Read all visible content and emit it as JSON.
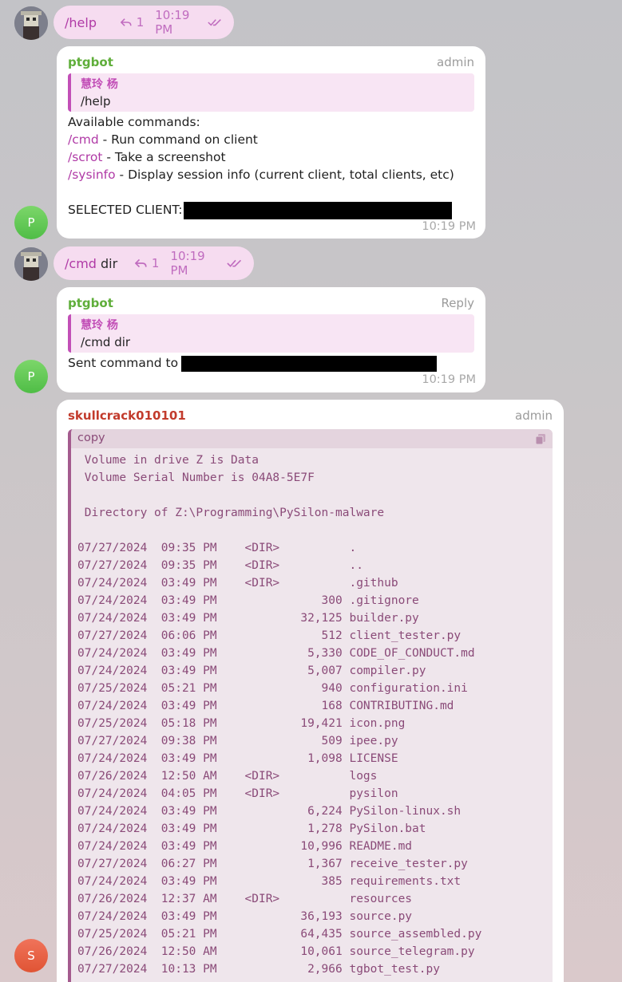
{
  "messages": {
    "m1": {
      "text": "/help",
      "reply_count": "1",
      "time": "10:19 PM"
    },
    "m2": {
      "sender": "ptgbot",
      "tag": "admin",
      "quote_name": "慧玲 杨",
      "quote_text": "/help",
      "heading": "Available commands:",
      "commands": [
        {
          "cmd": "/cmd",
          "desc": " - Run command on client"
        },
        {
          "cmd": "/scrot",
          "desc": " - Take a screenshot"
        },
        {
          "cmd": "/sysinfo",
          "desc": " - Display session info (current client, total clients, etc)"
        }
      ],
      "selected_label": "SELECTED CLIENT:",
      "time": "10:19 PM",
      "avatar_letter": "P"
    },
    "m3": {
      "cmd": "/cmd",
      "arg": " dir",
      "reply_count": "1",
      "time": "10:19 PM"
    },
    "m4": {
      "sender": "ptgbot",
      "tag": "Reply",
      "quote_name": "慧玲 杨",
      "quote_text": "/cmd dir",
      "text": "Sent command to",
      "time": "10:19 PM",
      "avatar_letter": "P"
    },
    "m5": {
      "sender": "skullcrack010101",
      "tag": "admin",
      "code_label": "copy",
      "avatar_letter": "S",
      "lines": [
        " Volume in drive Z is Data",
        " Volume Serial Number is 04A8-5E7F",
        "",
        " Directory of Z:\\Programming\\PySilon-malware",
        "",
        "07/27/2024  09:35 PM    <DIR>          .",
        "07/27/2024  09:35 PM    <DIR>          ..",
        "07/24/2024  03:49 PM    <DIR>          .github",
        "07/24/2024  03:49 PM               300 .gitignore",
        "07/24/2024  03:49 PM            32,125 builder.py",
        "07/27/2024  06:06 PM               512 client_tester.py",
        "07/24/2024  03:49 PM             5,330 CODE_OF_CONDUCT.md",
        "07/24/2024  03:49 PM             5,007 compiler.py",
        "07/25/2024  05:21 PM               940 configuration.ini",
        "07/24/2024  03:49 PM               168 CONTRIBUTING.md",
        "07/25/2024  05:18 PM            19,421 icon.png",
        "07/27/2024  09:38 PM               509 ipee.py",
        "07/24/2024  03:49 PM             1,098 LICENSE",
        "07/26/2024  12:50 AM    <DIR>          logs",
        "07/24/2024  04:05 PM    <DIR>          pysilon",
        "07/24/2024  03:49 PM             6,224 PySilon-linux.sh",
        "07/24/2024  03:49 PM             1,278 PySilon.bat",
        "07/24/2024  03:49 PM            10,996 README.md",
        "07/27/2024  06:27 PM             1,367 receive_tester.py",
        "07/24/2024  03:49 PM               385 requirements.txt",
        "07/26/2024  12:37 AM    <DIR>          resources",
        "07/24/2024  03:49 PM            36,193 source.py",
        "07/25/2024  05:21 PM            64,435 source_assembled.py",
        "07/26/2024  12:50 AM            10,061 source_telegram.py",
        "07/27/2024  10:13 PM             2,966 tgbot_test.py"
      ]
    }
  }
}
